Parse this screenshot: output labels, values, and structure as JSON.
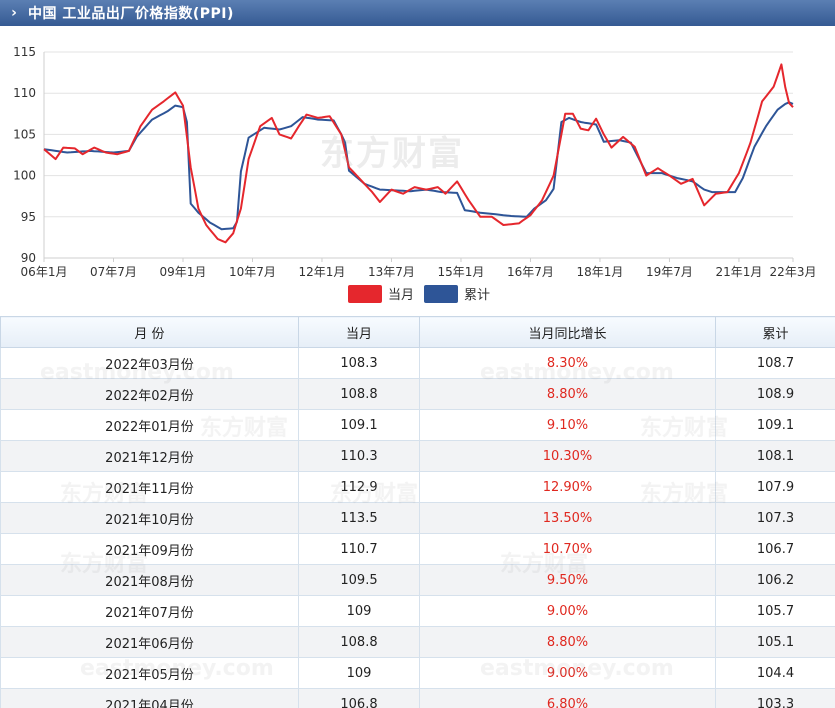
{
  "header": {
    "chevron": "›",
    "title": "中国 工业品出厂价格指数(PPI)"
  },
  "watermark": "东方财富",
  "watermark_en": "eastmoney.com",
  "colors": {
    "current": "#e5272d",
    "cumulative": "#2e5597",
    "header": "#3b639c",
    "red_text": "#e0281f"
  },
  "chart_data": {
    "type": "line",
    "x_tick_labels": [
      "06年1月",
      "07年7月",
      "09年1月",
      "10年7月",
      "12年1月",
      "13年7月",
      "15年1月",
      "16年7月",
      "18年1月",
      "19年7月",
      "21年1月",
      "22年3月"
    ],
    "x_tick_index": [
      0,
      18,
      36,
      54,
      72,
      90,
      108,
      126,
      144,
      162,
      180,
      194
    ],
    "y_ticks": [
      90,
      95,
      100,
      105,
      110,
      115
    ],
    "ylim": [
      90,
      115
    ],
    "x_count": 195,
    "grid": "horizontal",
    "legend_position": "bottom-center",
    "series": [
      {
        "name": "当月",
        "color": "#e5272d",
        "anchors": [
          [
            0,
            103.2
          ],
          [
            3,
            102.0
          ],
          [
            5,
            103.4
          ],
          [
            8,
            103.3
          ],
          [
            10,
            102.6
          ],
          [
            13,
            103.4
          ],
          [
            16,
            102.8
          ],
          [
            19,
            102.6
          ],
          [
            22,
            103.0
          ],
          [
            25,
            106.0
          ],
          [
            28,
            108.0
          ],
          [
            31,
            109.0
          ],
          [
            34,
            110.1
          ],
          [
            36,
            108.5
          ],
          [
            38,
            101.0
          ],
          [
            40,
            96.0
          ],
          [
            42,
            94.0
          ],
          [
            45,
            92.3
          ],
          [
            47,
            91.9
          ],
          [
            49,
            93.0
          ],
          [
            51,
            96.0
          ],
          [
            53,
            102.0
          ],
          [
            56,
            106.0
          ],
          [
            59,
            107.0
          ],
          [
            61,
            105.0
          ],
          [
            64,
            104.5
          ],
          [
            66,
            106.0
          ],
          [
            68,
            107.4
          ],
          [
            71,
            107.0
          ],
          [
            74,
            107.2
          ],
          [
            77,
            105.0
          ],
          [
            79,
            101.0
          ],
          [
            82,
            99.5
          ],
          [
            85,
            98.0
          ],
          [
            87,
            96.8
          ],
          [
            90,
            98.3
          ],
          [
            93,
            97.8
          ],
          [
            96,
            98.6
          ],
          [
            99,
            98.3
          ],
          [
            102,
            98.6
          ],
          [
            104,
            97.8
          ],
          [
            107,
            99.3
          ],
          [
            110,
            97.0
          ],
          [
            113,
            95.0
          ],
          [
            116,
            95.0
          ],
          [
            119,
            94.0
          ],
          [
            123,
            94.2
          ],
          [
            126,
            95.2
          ],
          [
            129,
            97.0
          ],
          [
            132,
            100.0
          ],
          [
            135,
            107.5
          ],
          [
            137,
            107.5
          ],
          [
            139,
            105.7
          ],
          [
            141,
            105.5
          ],
          [
            143,
            106.9
          ],
          [
            145,
            105.0
          ],
          [
            147,
            103.4
          ],
          [
            150,
            104.7
          ],
          [
            153,
            103.5
          ],
          [
            156,
            100.0
          ],
          [
            159,
            100.9
          ],
          [
            162,
            100.0
          ],
          [
            165,
            99.0
          ],
          [
            168,
            99.6
          ],
          [
            171,
            96.4
          ],
          [
            174,
            97.8
          ],
          [
            177,
            98.0
          ],
          [
            180,
            100.3
          ],
          [
            183,
            104.0
          ],
          [
            186,
            109.0
          ],
          [
            189,
            110.8
          ],
          [
            191,
            113.5
          ],
          [
            192,
            110.7
          ],
          [
            193,
            108.8
          ],
          [
            194,
            108.3
          ]
        ]
      },
      {
        "name": "累计",
        "color": "#2e5597",
        "anchors": [
          [
            0,
            103.2
          ],
          [
            6,
            102.8
          ],
          [
            12,
            103.0
          ],
          [
            18,
            102.8
          ],
          [
            22,
            103.0
          ],
          [
            24,
            104.7
          ],
          [
            28,
            106.8
          ],
          [
            32,
            107.8
          ],
          [
            34,
            108.5
          ],
          [
            36,
            108.3
          ],
          [
            37,
            106.5
          ],
          [
            38,
            96.6
          ],
          [
            40,
            95.5
          ],
          [
            43,
            94.3
          ],
          [
            46,
            93.5
          ],
          [
            49,
            93.6
          ],
          [
            50,
            94.4
          ],
          [
            51,
            100.5
          ],
          [
            53,
            104.6
          ],
          [
            57,
            105.8
          ],
          [
            61,
            105.6
          ],
          [
            64,
            106.0
          ],
          [
            67,
            107.1
          ],
          [
            71,
            106.8
          ],
          [
            75,
            106.7
          ],
          [
            77,
            105.0
          ],
          [
            78,
            104.0
          ],
          [
            79,
            100.6
          ],
          [
            83,
            99.0
          ],
          [
            87,
            98.3
          ],
          [
            91,
            98.2
          ],
          [
            95,
            98.1
          ],
          [
            99,
            98.3
          ],
          [
            103,
            98.0
          ],
          [
            107,
            97.9
          ],
          [
            109,
            95.8
          ],
          [
            113,
            95.5
          ],
          [
            117,
            95.3
          ],
          [
            121,
            95.1
          ],
          [
            125,
            95.0
          ],
          [
            127,
            96.0
          ],
          [
            130,
            97.0
          ],
          [
            132,
            98.4
          ],
          [
            134,
            106.5
          ],
          [
            136,
            107.0
          ],
          [
            139,
            106.5
          ],
          [
            143,
            106.2
          ],
          [
            145,
            104.1
          ],
          [
            149,
            104.3
          ],
          [
            152,
            104.0
          ],
          [
            156,
            100.3
          ],
          [
            160,
            100.3
          ],
          [
            164,
            99.7
          ],
          [
            168,
            99.3
          ],
          [
            171,
            98.3
          ],
          [
            173,
            98.0
          ],
          [
            176,
            98.0
          ],
          [
            179,
            98.0
          ],
          [
            181,
            99.7
          ],
          [
            184,
            103.5
          ],
          [
            187,
            106.0
          ],
          [
            190,
            108.0
          ],
          [
            192,
            108.7
          ],
          [
            193,
            108.9
          ],
          [
            194,
            108.7
          ]
        ]
      }
    ]
  },
  "table": {
    "headers": [
      "月 份",
      "当月",
      "当月同比增长",
      "累计"
    ],
    "rows": [
      [
        "2022年03月份",
        "108.3",
        "8.30%",
        "108.7"
      ],
      [
        "2022年02月份",
        "108.8",
        "8.80%",
        "108.9"
      ],
      [
        "2022年01月份",
        "109.1",
        "9.10%",
        "109.1"
      ],
      [
        "2021年12月份",
        "110.3",
        "10.30%",
        "108.1"
      ],
      [
        "2021年11月份",
        "112.9",
        "12.90%",
        "107.9"
      ],
      [
        "2021年10月份",
        "113.5",
        "13.50%",
        "107.3"
      ],
      [
        "2021年09月份",
        "110.7",
        "10.70%",
        "106.7"
      ],
      [
        "2021年08月份",
        "109.5",
        "9.50%",
        "106.2"
      ],
      [
        "2021年07月份",
        "109",
        "9.00%",
        "105.7"
      ],
      [
        "2021年06月份",
        "108.8",
        "8.80%",
        "105.1"
      ],
      [
        "2021年05月份",
        "109",
        "9.00%",
        "104.4"
      ],
      [
        "2021年04月份",
        "106.8",
        "6.80%",
        "103.3"
      ]
    ]
  }
}
